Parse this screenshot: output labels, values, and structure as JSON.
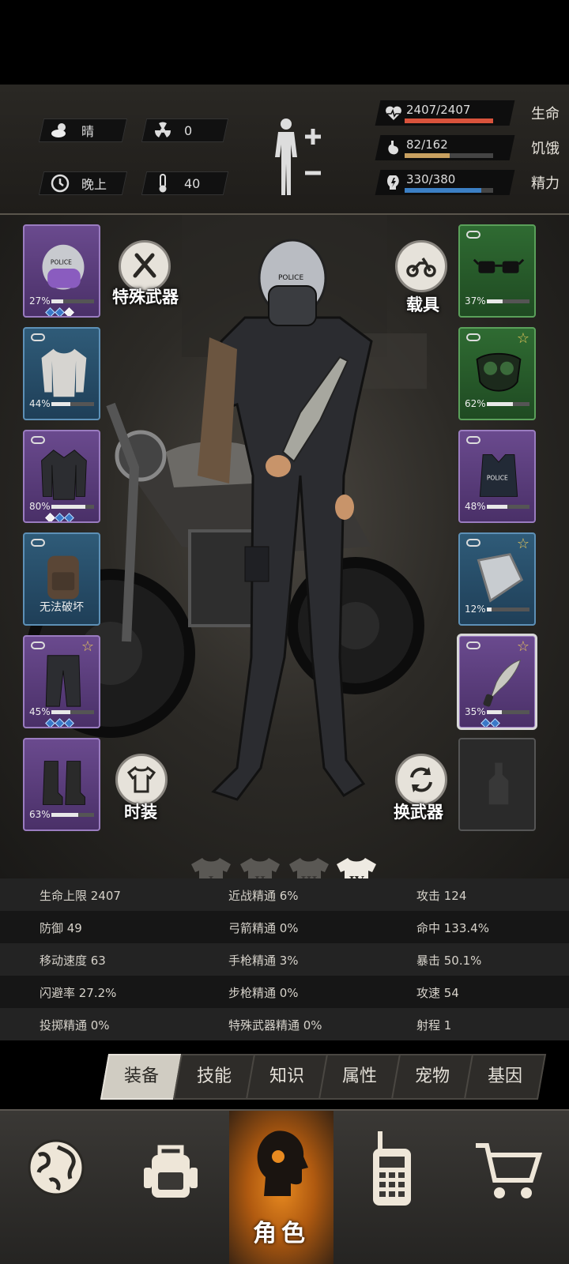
{
  "status": {
    "weather": {
      "icon": "cloud-sun-icon",
      "value": "晴"
    },
    "radiation": {
      "icon": "radiation-icon",
      "value": "0"
    },
    "time_of_day": {
      "icon": "clock-icon",
      "value": "晚上"
    },
    "temperature": {
      "icon": "thermometer-icon",
      "value": "40"
    },
    "vitals": [
      {
        "icon": "heart-pulse-icon",
        "value": "2407/2407",
        "label": "生命",
        "fill": 1.0,
        "color": "#d9533c"
      },
      {
        "icon": "stomach-icon",
        "value": "82/162",
        "label": "饥饿",
        "fill": 0.506,
        "color": "#c8a060"
      },
      {
        "icon": "energy-icon",
        "value": "330/380",
        "label": "精力",
        "fill": 0.868,
        "color": "#3c7fc4"
      }
    ]
  },
  "equipment": {
    "left": [
      {
        "slot": "helmet",
        "rarity": "purple",
        "durability": "27%",
        "fill": 0.27,
        "gems": [
          "blue",
          "blue",
          "white"
        ],
        "icon": "police-helmet-icon"
      },
      {
        "slot": "shirt",
        "rarity": "blue",
        "durability": "44%",
        "fill": 0.44,
        "gems": [],
        "link": true,
        "icon": "long-shirt-icon"
      },
      {
        "slot": "jacket",
        "rarity": "purple",
        "durability": "80%",
        "fill": 0.8,
        "gems": [
          "white",
          "blue",
          "blue"
        ],
        "link": true,
        "icon": "jacket-icon"
      },
      {
        "slot": "backpack",
        "rarity": "blue",
        "durability": "",
        "fill": 0,
        "gems": [],
        "link": true,
        "unbreakable": "无法破坏",
        "icon": "backpack-icon"
      },
      {
        "slot": "pants",
        "rarity": "purple",
        "durability": "45%",
        "fill": 0.45,
        "gems": [
          "blue",
          "blue",
          "blue"
        ],
        "link": true,
        "star": true,
        "icon": "pants-icon"
      },
      {
        "slot": "boots",
        "rarity": "purple",
        "durability": "63%",
        "fill": 0.63,
        "gems": [],
        "icon": "boots-icon"
      }
    ],
    "right": [
      {
        "slot": "glasses",
        "rarity": "green",
        "durability": "37%",
        "fill": 0.37,
        "gems": [],
        "link": true,
        "icon": "glasses-icon"
      },
      {
        "slot": "mask",
        "rarity": "green",
        "durability": "62%",
        "fill": 0.62,
        "gems": [],
        "link": true,
        "star": true,
        "icon": "gas-mask-icon"
      },
      {
        "slot": "vest",
        "rarity": "purple",
        "durability": "48%",
        "fill": 0.48,
        "gems": [],
        "link": true,
        "icon": "police-vest-icon",
        "vest_text": "POLICE"
      },
      {
        "slot": "shield",
        "rarity": "blue",
        "durability": "12%",
        "fill": 0.12,
        "gems": [],
        "link": true,
        "star": true,
        "icon": "shield-icon"
      },
      {
        "slot": "weapon",
        "rarity": "purple",
        "durability": "35%",
        "fill": 0.35,
        "gems": [
          "blue",
          "blue"
        ],
        "link": true,
        "star": true,
        "selected": true,
        "icon": "machete-icon"
      },
      {
        "slot": "throwable",
        "rarity": "empty",
        "durability": "",
        "fill": 0,
        "gems": [],
        "icon": "bottle-icon"
      }
    ]
  },
  "buttons": {
    "special_weapon": "特殊武器",
    "vehicle": "载具",
    "fashion": "时装",
    "swap_weapon": "换武器"
  },
  "helmet_text": "POLICE",
  "outfit_tabs": [
    "I",
    "II",
    "III",
    "IV"
  ],
  "outfit_active": 3,
  "stats": [
    [
      "生命上限 2407",
      "近战精通 6%",
      "攻击 124"
    ],
    [
      "防御 49",
      "弓箭精通 0%",
      "命中 133.4%"
    ],
    [
      "移动速度 63",
      "手枪精通 3%",
      "暴击 50.1%"
    ],
    [
      "闪避率 27.2%",
      "步枪精通 0%",
      "攻速 54"
    ],
    [
      "投掷精通 0%",
      "特殊武器精通 0%",
      "射程 1"
    ]
  ],
  "tabs": [
    "装备",
    "技能",
    "知识",
    "属性",
    "宠物",
    "基因"
  ],
  "active_tab": 0,
  "bottom_nav": {
    "items": [
      {
        "icon": "globe-icon"
      },
      {
        "icon": "backpack-icon"
      },
      {
        "icon": "character-head-icon",
        "label": "角色",
        "active": true
      },
      {
        "icon": "walkie-talkie-icon"
      },
      {
        "icon": "shopping-cart-icon"
      }
    ]
  }
}
